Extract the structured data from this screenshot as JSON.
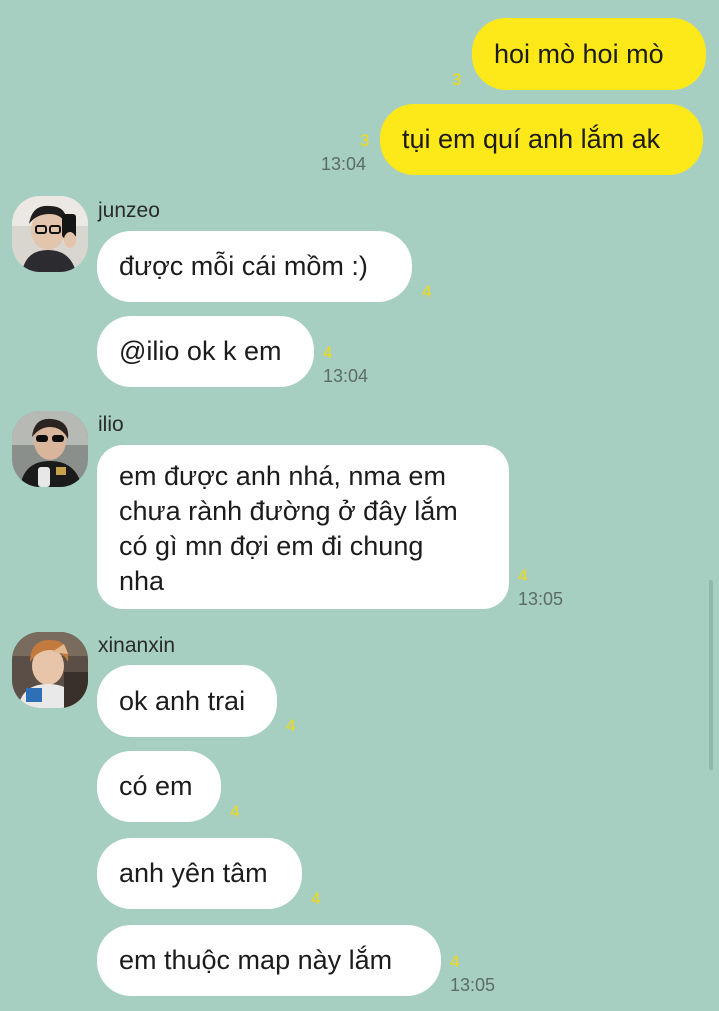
{
  "theme": {
    "background": "#a6cfc2",
    "outgoing_bubble": "#fde81a",
    "incoming_bubble": "#ffffff",
    "unread_color": "#f2d90d"
  },
  "outgoing": [
    {
      "text": "hoi mò hoi mò",
      "unread": "3"
    },
    {
      "text": "tụi em quí anh lắm ak",
      "unread": "3",
      "time": "13:04"
    }
  ],
  "groups": [
    {
      "sender": "junzeo",
      "avatar_icon": "profile-photo-icon",
      "messages": [
        {
          "text": "được mỗi cái mồm :)",
          "unread": "4"
        },
        {
          "text": "@ilio ok k em",
          "unread": "4",
          "time": "13:04"
        }
      ]
    },
    {
      "sender": "ilio",
      "avatar_icon": "profile-photo-icon",
      "messages": [
        {
          "text": "em được anh nhá, nma em\nchưa rành đường ở đây lắm\ncó gì mn đợi em đi chung\nnha",
          "unread": "4",
          "time": "13:05"
        }
      ]
    },
    {
      "sender": "xinanxin",
      "avatar_icon": "profile-photo-icon",
      "messages": [
        {
          "text": "ok anh trai",
          "unread": "4"
        },
        {
          "text": "có em",
          "unread": "4"
        },
        {
          "text": "anh yên tâm",
          "unread": "4"
        },
        {
          "text": "em thuộc map này lắm",
          "unread": "4",
          "time": "13:05"
        }
      ]
    }
  ]
}
